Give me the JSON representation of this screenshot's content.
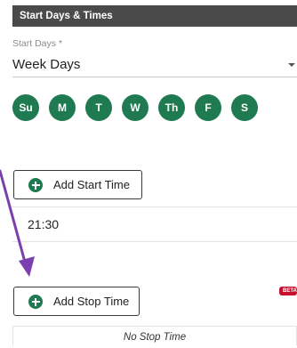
{
  "header": {
    "title": "Start Days & Times"
  },
  "start_days": {
    "label": "Start Days *",
    "value": "Week Days",
    "caret_icon": "caret-down-icon"
  },
  "days": [
    {
      "label": "Su",
      "selected": true
    },
    {
      "label": "M",
      "selected": true
    },
    {
      "label": "T",
      "selected": true
    },
    {
      "label": "W",
      "selected": true
    },
    {
      "label": "Th",
      "selected": true
    },
    {
      "label": "F",
      "selected": true
    },
    {
      "label": "S",
      "selected": true
    }
  ],
  "add_start_time": {
    "label": "Add Start Time",
    "icon": "plus-circle-icon"
  },
  "start_times": [
    "21:30"
  ],
  "add_stop_time": {
    "label": "Add Stop Time",
    "icon": "plus-circle-icon"
  },
  "beta_badge": "BETA",
  "no_stop_time": "No Stop Time",
  "colors": {
    "accent": "#1f7a52",
    "header_bg": "#4a4a4a",
    "annotation_arrow": "#7b3fb0",
    "beta": "#c8102e"
  }
}
